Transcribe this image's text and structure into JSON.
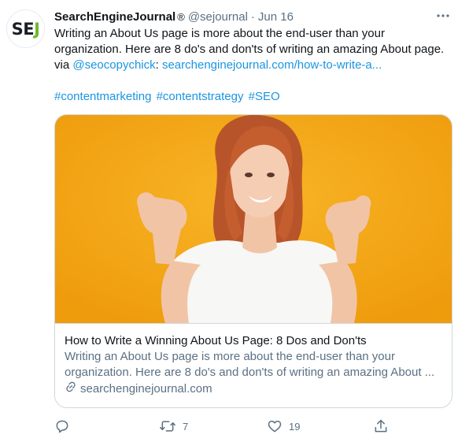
{
  "tweet": {
    "avatar_text": {
      "s": "S",
      "e": "E",
      "j": "J"
    },
    "display_name": "SearchEngineJournal",
    "verified_mark": "®",
    "handle": "@sejournal",
    "separator": "·",
    "date": "Jun 16",
    "text_lines": [
      "Writing an About Us page is more about the end-user than your",
      "organization. Here are 8 do's and don'ts of writing an amazing About page."
    ],
    "via_prefix": "via ",
    "mention": "@seocopychick",
    "colon": ":",
    "link_text": " searchenginejournal.com/how-to-write-a...",
    "hashtags": [
      "#contentmarketing",
      "#contentstrategy",
      "#SEO"
    ],
    "card": {
      "title": "How to Write a Winning About Us Page: 8 Dos and Don'ts",
      "desc_lines": [
        "Writing an About Us page is more about the end-user than your",
        "organization. Here are 8 do's and don'ts of writing an amazing About ..."
      ],
      "domain": "searchenginejournal.com"
    },
    "actions": {
      "reply_icon": "reply-icon",
      "retweet_icon": "retweet-icon",
      "retweet_count": "7",
      "like_icon": "heart-icon",
      "like_count": "19",
      "share_icon": "share-icon"
    }
  },
  "colors": {
    "link": "#1b95e0",
    "secondary_text": "#5b7083",
    "image_background": "#f4a512",
    "brand_green": "#6fba2c"
  }
}
